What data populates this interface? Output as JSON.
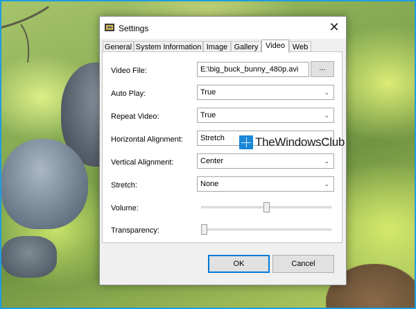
{
  "window": {
    "title": "Settings",
    "close_glyph": "✕"
  },
  "tabs": [
    {
      "label": "General",
      "active": false
    },
    {
      "label": "System Information",
      "active": false
    },
    {
      "label": "Image",
      "active": false
    },
    {
      "label": "Gallery",
      "active": false
    },
    {
      "label": "Video",
      "active": true
    },
    {
      "label": "Web",
      "active": false
    }
  ],
  "video": {
    "video_file": {
      "label": "Video File:",
      "value": "E:\\big_buck_bunny_480p.avi",
      "browse_label": "..."
    },
    "auto_play": {
      "label": "Auto Play:",
      "value": "True"
    },
    "repeat_video": {
      "label": "Repeat Video:",
      "value": "True"
    },
    "horizontal_alignment": {
      "label": "Horizontal Alignment:",
      "value": "Stretch"
    },
    "vertical_alignment": {
      "label": "Vertical Alignment:",
      "value": "Center"
    },
    "stretch": {
      "label": "Stretch:",
      "value": "None"
    },
    "volume": {
      "label": "Volume:",
      "level": 0.5
    },
    "transparency": {
      "label": "Transparency:",
      "level": 0.0
    }
  },
  "buttons": {
    "ok": "OK",
    "cancel": "Cancel"
  },
  "watermark": {
    "text": "TheWindowsClub"
  },
  "icons": {
    "dropdown": "chevron-down-icon",
    "app": "settings-app-icon",
    "close": "close-icon"
  },
  "colors": {
    "accent": "#0078d7",
    "frame": "#1f9de0"
  }
}
